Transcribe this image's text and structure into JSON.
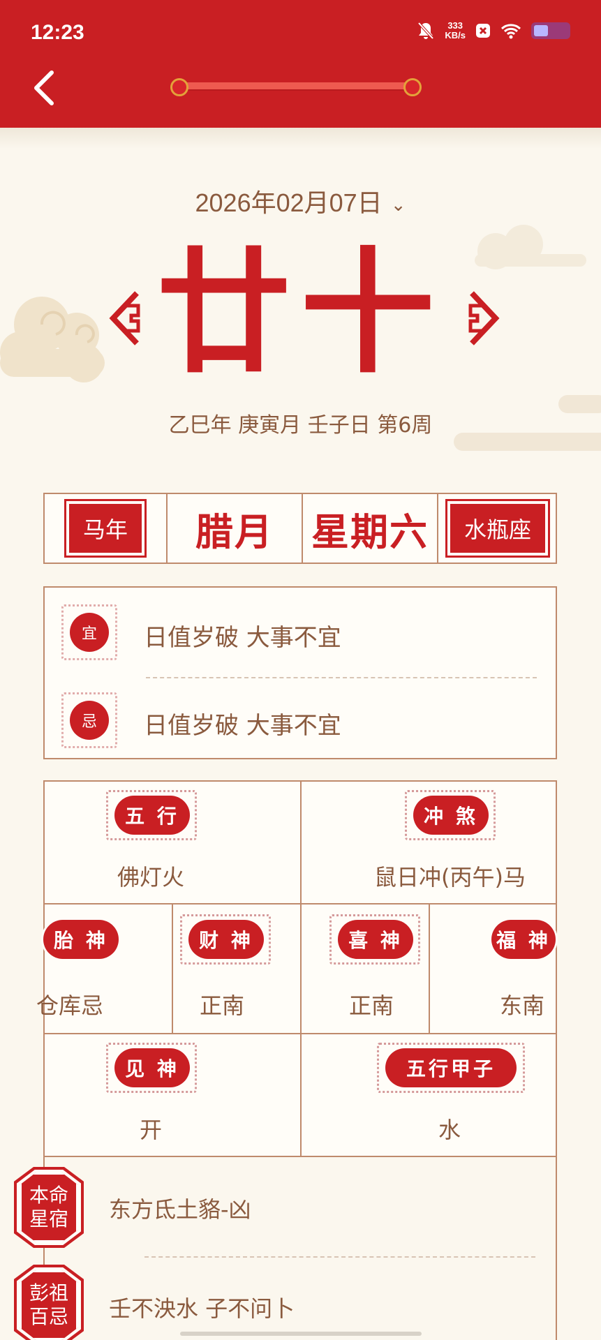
{
  "status_bar": {
    "time": "12:23",
    "net_speed_value": "333",
    "net_speed_unit": "KB/s",
    "icons": [
      "mute-icon",
      "close-box-icon",
      "wifi-icon",
      "battery-icon"
    ]
  },
  "header": {
    "back_icon": "chevron-left-icon",
    "accent": "#c91f23"
  },
  "date_selector": {
    "date": "2026年02月07日",
    "chevron_icon": "chevron-down-icon"
  },
  "lunar": {
    "day": "廿十",
    "ganzhi": "乙巳年 庚寅月 壬子日 第6周"
  },
  "band": {
    "zodiac_year": "马年",
    "lunar_month": "腊月",
    "weekday": "星期六",
    "constellation": "水瓶座"
  },
  "yiji": {
    "yi_label": "宜",
    "yi_text": "日值岁破 大事不宜",
    "ji_label": "忌",
    "ji_text": "日值岁破 大事不宜"
  },
  "grid": {
    "wuxing_label": "五 行",
    "wuxing_value": "佛灯火",
    "chongsha_label": "冲 煞",
    "chongsha_value": "鼠日冲(丙午)马",
    "taishen_label": "胎 神",
    "taishen_value": "仓库忌",
    "caishen_label": "财 神",
    "caishen_value": "正南",
    "xishen_label": "喜 神",
    "xishen_value": "正南",
    "fushen_label": "福 神",
    "fushen_value": "东南",
    "jianshen_label": "见 神",
    "jianshen_value": "开",
    "wuxing_jiazi_label": "五行甲子",
    "wuxing_jiazi_value": "水"
  },
  "bottom": {
    "benming_label_1": "本命",
    "benming_label_2": "星宿",
    "benming_value": "东方氐土貉-凶",
    "pengzu_label_1": "彭祖",
    "pengzu_label_2": "百忌",
    "pengzu_value": "壬不泱水 子不问卜"
  }
}
